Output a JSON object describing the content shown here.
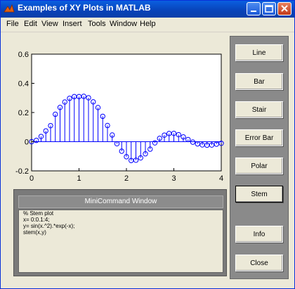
{
  "window": {
    "title": "Examples of XY Plots in MATLAB"
  },
  "menu": {
    "items": [
      "File",
      "Edit",
      "View",
      "Insert",
      "Tools",
      "Window",
      "Help"
    ]
  },
  "chart_data": {
    "type": "scatter",
    "style": "stem",
    "marker": "circle-open",
    "color": "#0000ff",
    "xlim": [
      0,
      4
    ],
    "ylim": [
      -0.2,
      0.6
    ],
    "xticks": [
      "0",
      "1",
      "2",
      "3",
      "4"
    ],
    "yticks": [
      "-0.2",
      "0",
      "0.2",
      "0.4",
      "0.6"
    ],
    "x": [
      0.0,
      0.1,
      0.2,
      0.3,
      0.4,
      0.5,
      0.6,
      0.7,
      0.8,
      0.9,
      1.0,
      1.1,
      1.2,
      1.3,
      1.4,
      1.5,
      1.6,
      1.7,
      1.8,
      1.9,
      2.0,
      2.1,
      2.2,
      2.3,
      2.4,
      2.5,
      2.6,
      2.7,
      2.8,
      2.9,
      3.0,
      3.1,
      3.2,
      3.3,
      3.4,
      3.5,
      3.6,
      3.7,
      3.8,
      3.9,
      4.0
    ],
    "y": [
      0.0,
      0.009,
      0.036,
      0.074,
      0.11,
      0.188,
      0.235,
      0.272,
      0.297,
      0.309,
      0.309,
      0.311,
      0.301,
      0.273,
      0.234,
      0.174,
      0.111,
      0.046,
      -0.014,
      -0.065,
      -0.103,
      -0.129,
      -0.127,
      -0.111,
      -0.083,
      -0.051,
      -0.008,
      0.023,
      0.045,
      0.056,
      0.057,
      0.048,
      0.033,
      0.015,
      -0.003,
      -0.015,
      -0.022,
      -0.024,
      -0.023,
      -0.017,
      -0.011
    ]
  },
  "mini_command": {
    "title": "MiniCommand Window",
    "lines": [
      "% Stem plot",
      "x= 0:0.1:4;",
      "y= sin(x.^2).*exp(-x);",
      "stem(x,y)"
    ]
  },
  "buttons": {
    "line": "Line",
    "bar": "Bar",
    "stair": "Stair",
    "errorbar": "Error Bar",
    "polar": "Polar",
    "stem": "Stem",
    "info": "Info",
    "close": "Close"
  }
}
